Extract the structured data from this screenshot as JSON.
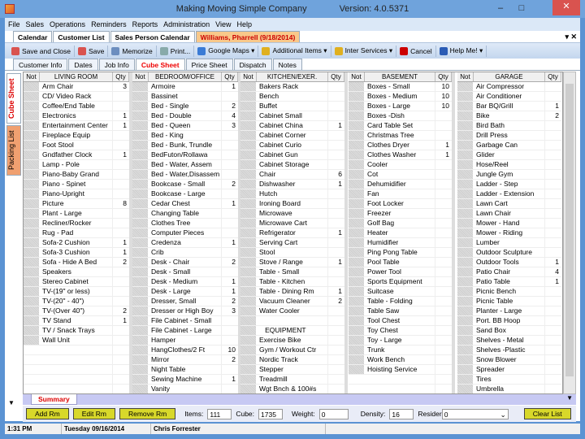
{
  "window": {
    "title": "Making Moving Simple Company",
    "version": "Version: 4.0.5371"
  },
  "menu": [
    "File",
    "Sales",
    "Operations",
    "Reminders",
    "Reports",
    "Administration",
    "View",
    "Help"
  ],
  "doc_tabs": [
    {
      "label": "Calendar"
    },
    {
      "label": "Customer List"
    },
    {
      "label": "Sales Person Calendar"
    },
    {
      "label": "Williams, Pharrell  (9/18/2014)",
      "active": true
    }
  ],
  "toolbar": [
    {
      "label": "Save and Close",
      "icon": "save-close-icon",
      "color": "#d9534f"
    },
    {
      "label": "Save",
      "icon": "save-icon",
      "color": "#d9534f"
    },
    {
      "label": "Memorize",
      "icon": "memorize-icon",
      "color": "#6c8ebf"
    },
    {
      "label": "Print...",
      "icon": "print-icon",
      "color": "#8aa"
    },
    {
      "label": "Google Maps ▾",
      "icon": "globe-icon",
      "color": "#3a7bd5"
    },
    {
      "label": "Additional Items ▾",
      "icon": "items-icon",
      "color": "#e0b020"
    },
    {
      "label": "Inter Services ▾",
      "icon": "services-icon",
      "color": "#e0b020"
    },
    {
      "label": "Cancel",
      "icon": "cancel-icon",
      "color": "#c00"
    },
    {
      "label": "Help Me! ▾",
      "icon": "help-icon",
      "color": "#2a5bb5"
    }
  ],
  "sub_tabs": [
    {
      "label": "Customer Info"
    },
    {
      "label": "Dates"
    },
    {
      "label": "Job Info"
    },
    {
      "label": "Cube Sheet",
      "active": true
    },
    {
      "label": "Price Sheet"
    },
    {
      "label": "Dispatch"
    },
    {
      "label": "Notes"
    }
  ],
  "side_tabs": [
    "Cube Sheet",
    "Packing List"
  ],
  "grid": {
    "not_header": "Not",
    "qty_header": "Qty",
    "rooms": [
      {
        "name": "LIVING ROOM",
        "items": [
          [
            "Arm Chair",
            "3"
          ],
          [
            "CD/ Video Rack",
            ""
          ],
          [
            "Coffee/End Table",
            ""
          ],
          [
            "Electronics",
            "1"
          ],
          [
            "Entertainment Center",
            "1"
          ],
          [
            "Fireplace Equip",
            ""
          ],
          [
            "Foot Stool",
            ""
          ],
          [
            "Gndfather Clock",
            "1"
          ],
          [
            "Lamp - Pole",
            ""
          ],
          [
            "Piano-Baby Grand",
            ""
          ],
          [
            "Piano - Spinet",
            ""
          ],
          [
            "Piano-Upright",
            ""
          ],
          [
            "Picture",
            "8"
          ],
          [
            "Plant - Large",
            ""
          ],
          [
            "Recliner/Rocker",
            ""
          ],
          [
            "Rug - Pad",
            ""
          ],
          [
            "Sofa-2 Cushion",
            "1"
          ],
          [
            "Sofa-3 Cushion",
            "1"
          ],
          [
            "Sofa - Hide A Bed",
            "2"
          ],
          [
            "Speakers",
            ""
          ],
          [
            "Stereo Cabinet",
            ""
          ],
          [
            "TV-(19\" or less)",
            ""
          ],
          [
            "TV-(20\" - 40\")",
            ""
          ],
          [
            "TV-(Over 40\")",
            "2"
          ],
          [
            "TV Stand",
            "1"
          ],
          [
            "TV / Snack Trays",
            ""
          ],
          [
            "Wall Unit",
            ""
          ]
        ]
      },
      {
        "name": "BEDROOM/OFFICE",
        "items": [
          [
            "Armoire",
            "1"
          ],
          [
            "Bassinet",
            ""
          ],
          [
            "Bed - Single",
            "2"
          ],
          [
            "Bed - Double",
            "4"
          ],
          [
            "Bed - Queen",
            "3"
          ],
          [
            "Bed - King",
            ""
          ],
          [
            "Bed - Bunk, Trundle",
            ""
          ],
          [
            "BedFuton/Rollawa",
            ""
          ],
          [
            "Bed - Water, Assem",
            ""
          ],
          [
            "Bed - Water,Disassem",
            ""
          ],
          [
            "Bookcase - Small",
            "2"
          ],
          [
            "Bookcase - Large",
            ""
          ],
          [
            "Cedar Chest",
            "1"
          ],
          [
            "Changing Table",
            ""
          ],
          [
            "Clothes Tree",
            ""
          ],
          [
            "Computer Pieces",
            ""
          ],
          [
            "Credenza",
            "1"
          ],
          [
            "Crib",
            ""
          ],
          [
            "Desk - Chair",
            "2"
          ],
          [
            "Desk - Small",
            ""
          ],
          [
            "Desk - Medium",
            "1"
          ],
          [
            "Desk - Large",
            "1"
          ],
          [
            "Dresser, Small",
            "2"
          ],
          [
            "Dresser or High Boy",
            "3"
          ],
          [
            "File Cabinet - Small",
            ""
          ],
          [
            "File Cabinet - Large",
            ""
          ],
          [
            "Hamper",
            ""
          ],
          [
            "HangClothes/2 Ft",
            "10"
          ],
          [
            "Mirror",
            "2"
          ],
          [
            "Night Table",
            ""
          ],
          [
            "Sewing Machine",
            "1"
          ],
          [
            "Vanity",
            ""
          ]
        ]
      },
      {
        "name": "KITCHEN/EXER.",
        "items": [
          [
            "Bakers Rack",
            ""
          ],
          [
            "Bench",
            ""
          ],
          [
            "Buffet",
            ""
          ],
          [
            "Cabinet Small",
            ""
          ],
          [
            "Cabinet China",
            "1"
          ],
          [
            "Cabinet Corner",
            ""
          ],
          [
            "Cabinet Curio",
            ""
          ],
          [
            "Cabinet Gun",
            ""
          ],
          [
            "Cabinet Storage",
            ""
          ],
          [
            "Chair",
            "6"
          ],
          [
            "Dishwasher",
            "1"
          ],
          [
            "Hutch",
            ""
          ],
          [
            "Ironing Board",
            ""
          ],
          [
            "Microwave",
            ""
          ],
          [
            "Microwave Cart",
            ""
          ],
          [
            "Refrigerator",
            "1"
          ],
          [
            "Serving Cart",
            ""
          ],
          [
            "Stool",
            ""
          ],
          [
            "Stove / Range",
            "1"
          ],
          [
            "Table - Small",
            ""
          ],
          [
            "Table - Kitchen",
            ""
          ],
          [
            "Table - Dining Rm",
            "1"
          ],
          [
            "Vacuum Cleaner",
            "2"
          ],
          [
            "Water Cooler",
            ""
          ],
          [
            "",
            ""
          ],
          [
            "   EQUIPMENT",
            ""
          ],
          [
            "Exercise Bike",
            ""
          ],
          [
            "Gym / Workout Ctr",
            ""
          ],
          [
            "Nordic Track",
            ""
          ],
          [
            "Stepper",
            ""
          ],
          [
            "Treadmill",
            ""
          ],
          [
            "Wgt Bnch & 100#s",
            ""
          ]
        ]
      },
      {
        "name": "BASEMENT",
        "items": [
          [
            "Boxes - Small",
            "10"
          ],
          [
            "Boxes - Medium",
            "10"
          ],
          [
            "Boxes - Large",
            "10"
          ],
          [
            "Boxes -Dish",
            ""
          ],
          [
            "Card Table Set",
            ""
          ],
          [
            "Christmas Tree",
            ""
          ],
          [
            "Clothes Dryer",
            "1"
          ],
          [
            "Clothes Washer",
            "1"
          ],
          [
            "Cooler",
            ""
          ],
          [
            "Cot",
            ""
          ],
          [
            "Dehumidifier",
            ""
          ],
          [
            "Fan",
            ""
          ],
          [
            "Foot Locker",
            ""
          ],
          [
            "Freezer",
            ""
          ],
          [
            "Golf Bag",
            ""
          ],
          [
            "Heater",
            ""
          ],
          [
            "Humidifier",
            ""
          ],
          [
            "Ping Pong Table",
            ""
          ],
          [
            "Pool Table",
            ""
          ],
          [
            "Power Tool",
            ""
          ],
          [
            "Sports Equipment",
            ""
          ],
          [
            "Suitcase",
            ""
          ],
          [
            "Table - Folding",
            ""
          ],
          [
            "Table Saw",
            ""
          ],
          [
            "Tool Chest",
            ""
          ],
          [
            "Toy Chest",
            ""
          ],
          [
            "Toy - Large",
            ""
          ],
          [
            "Trunk",
            ""
          ],
          [
            "Work Bench",
            ""
          ],
          [
            "Hoisting Service",
            ""
          ]
        ]
      },
      {
        "name": "GARAGE",
        "items": [
          [
            "Air Compressor",
            ""
          ],
          [
            "Air Conditioner",
            ""
          ],
          [
            "Bar BQ/Grill",
            "1"
          ],
          [
            "Bike",
            "2"
          ],
          [
            "Bird Bath",
            ""
          ],
          [
            "Drill Press",
            ""
          ],
          [
            "Garbage Can",
            ""
          ],
          [
            "Glider",
            ""
          ],
          [
            "Hose/Reel",
            ""
          ],
          [
            "Jungle Gym",
            ""
          ],
          [
            "Ladder - Step",
            ""
          ],
          [
            "Ladder - Extension",
            ""
          ],
          [
            "Lawn Cart",
            ""
          ],
          [
            "Lawn Chair",
            ""
          ],
          [
            "Mower - Hand",
            ""
          ],
          [
            "Mower - Riding",
            ""
          ],
          [
            "Lumber",
            ""
          ],
          [
            "Outdoor Sculpture",
            ""
          ],
          [
            "Outdoor Tools",
            "1"
          ],
          [
            "Patio Chair",
            "4"
          ],
          [
            "Patio Table",
            "1"
          ],
          [
            "Picnic Bench",
            ""
          ],
          [
            "Picnic Table",
            ""
          ],
          [
            "Planter - Large",
            ""
          ],
          [
            "Port. BB Hoop",
            ""
          ],
          [
            "Sand Box",
            ""
          ],
          [
            "Shelves - Metal",
            ""
          ],
          [
            "Shelves -Plastic",
            ""
          ],
          [
            "Snow Blower",
            ""
          ],
          [
            "Spreader",
            ""
          ],
          [
            "Tires",
            ""
          ],
          [
            "Umbrella",
            ""
          ]
        ]
      }
    ]
  },
  "summary_tab": "Summary",
  "bottom": {
    "add_rm": "Add Rm",
    "edit_rm": "Edit Rm",
    "remove_rm": "Remove Rm",
    "items_label": "Items:",
    "items": "111",
    "cube_label": "Cube:",
    "cube": "1735",
    "weight_label": "Weight:",
    "weight": "0",
    "density_label": "Density:",
    "density": "16",
    "resider_label": "Resider",
    "resider": "0",
    "clear_list": "Clear List"
  },
  "status": {
    "time": "1:31 PM",
    "date": "Tuesday 09/16/2014",
    "user": "Chris Forrester"
  }
}
